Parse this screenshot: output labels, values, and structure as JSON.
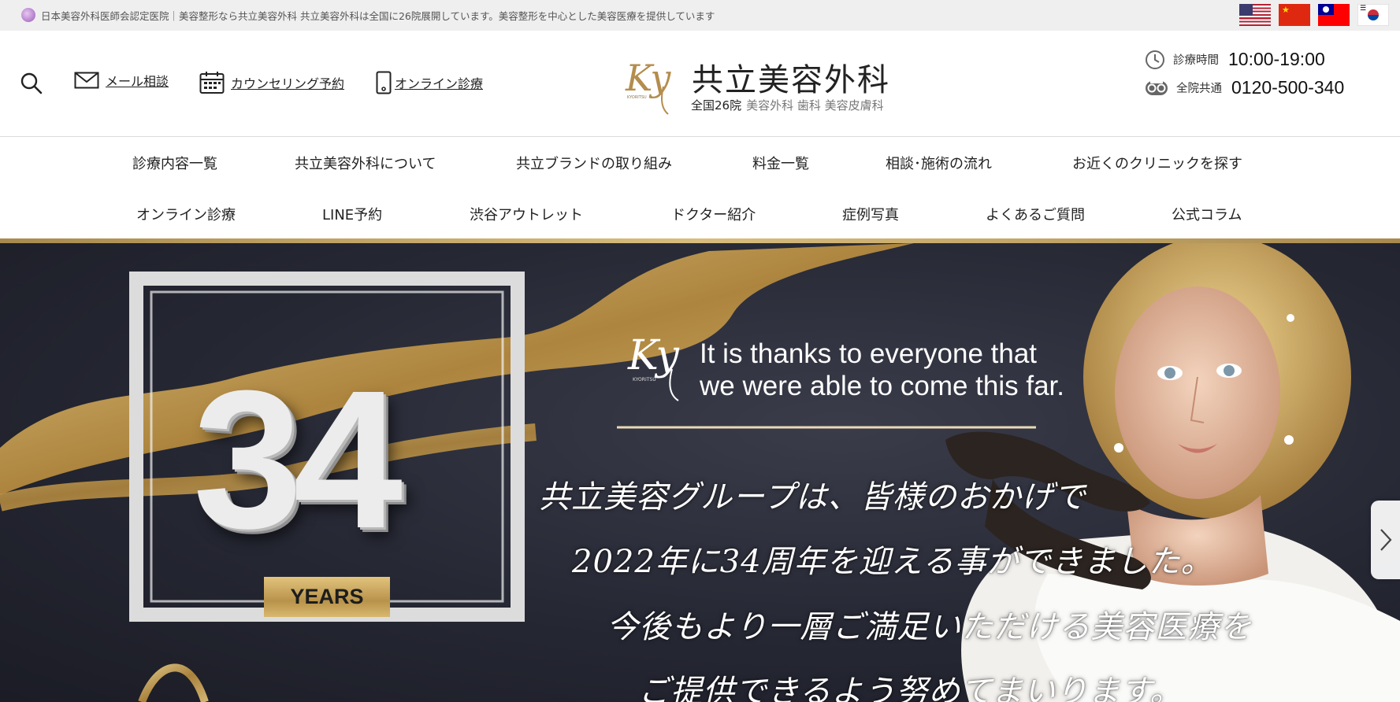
{
  "topbar": {
    "tagline": "日本美容外科医師会認定医院｜美容整形なら共立美容外科 共立美容外科は全国に26院展開しています。美容整形を中心とした美容医療を提供しています",
    "languages": [
      "English",
      "简体中文",
      "繁體中文",
      "한국어"
    ]
  },
  "header": {
    "links": {
      "mail": "メール相談",
      "counseling": "カウンセリング予約",
      "online": "オンライン診療"
    },
    "logo": {
      "mark": "Ky",
      "mark_small": "KYORITSU",
      "name": "共立美容外科",
      "clinics": "全国26院",
      "departments": "美容外科 歯科 美容皮膚科"
    },
    "hours_label": "診療時間",
    "hours_value": "10:00-19:00",
    "phone_label": "全院共通",
    "phone_value": "0120-500-340"
  },
  "nav": {
    "row1": [
      "診療内容一覧",
      "共立美容外科について",
      "共立ブランドの取り組み",
      "料金一覧",
      "相談･施術の流れ",
      "お近くのクリニックを探す"
    ],
    "row2": [
      "オンライン診療",
      "LINE予約",
      "渋谷アウトレット",
      "ドクター紹介",
      "症例写真",
      "よくあるご質問",
      "公式コラム"
    ]
  },
  "hero": {
    "big_number": "34",
    "years_label": "YEARS",
    "mark": "Ky",
    "mark_small": "KYORITSU",
    "english_line1": "It is thanks to everyone that",
    "english_line2": "we were able to come this far.",
    "jp_lines": [
      "共立美容グループは、皆様のおかげで",
      "2022年に34周年を迎える事ができました。",
      "今後もより一層ご満足いただける美容医療を",
      "ご提供できるよう努めてまいります。"
    ],
    "accent_color": "#c9a45c"
  }
}
